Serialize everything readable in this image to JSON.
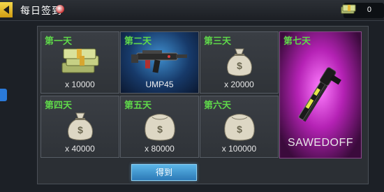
{
  "header": {
    "title": "每日签到",
    "currency_value": "0"
  },
  "days": [
    {
      "label": "第一天",
      "reward": "x 10000",
      "icon": "cash-stack-icon"
    },
    {
      "label": "第二天",
      "reward": "UMP45",
      "icon": "submachine-gun-icon"
    },
    {
      "label": "第三天",
      "reward": "x 20000",
      "icon": "money-bag-icon"
    },
    {
      "label": "第四天",
      "reward": "x 40000",
      "icon": "money-bag-icon"
    },
    {
      "label": "第五天",
      "reward": "x 80000",
      "icon": "money-bag-icon"
    },
    {
      "label": "第六天",
      "reward": "x 100000",
      "icon": "money-bag-icon"
    },
    {
      "label": "第七天",
      "reward": "SAWEDOFF",
      "icon": "shotgun-icon"
    }
  ],
  "claim_button": "得到",
  "colors": {
    "day_label": "#5fd84a",
    "claim_button": "#3a94d0",
    "gun_bg": "#1e4f8a",
    "legendary_bg": "#b522b5"
  }
}
